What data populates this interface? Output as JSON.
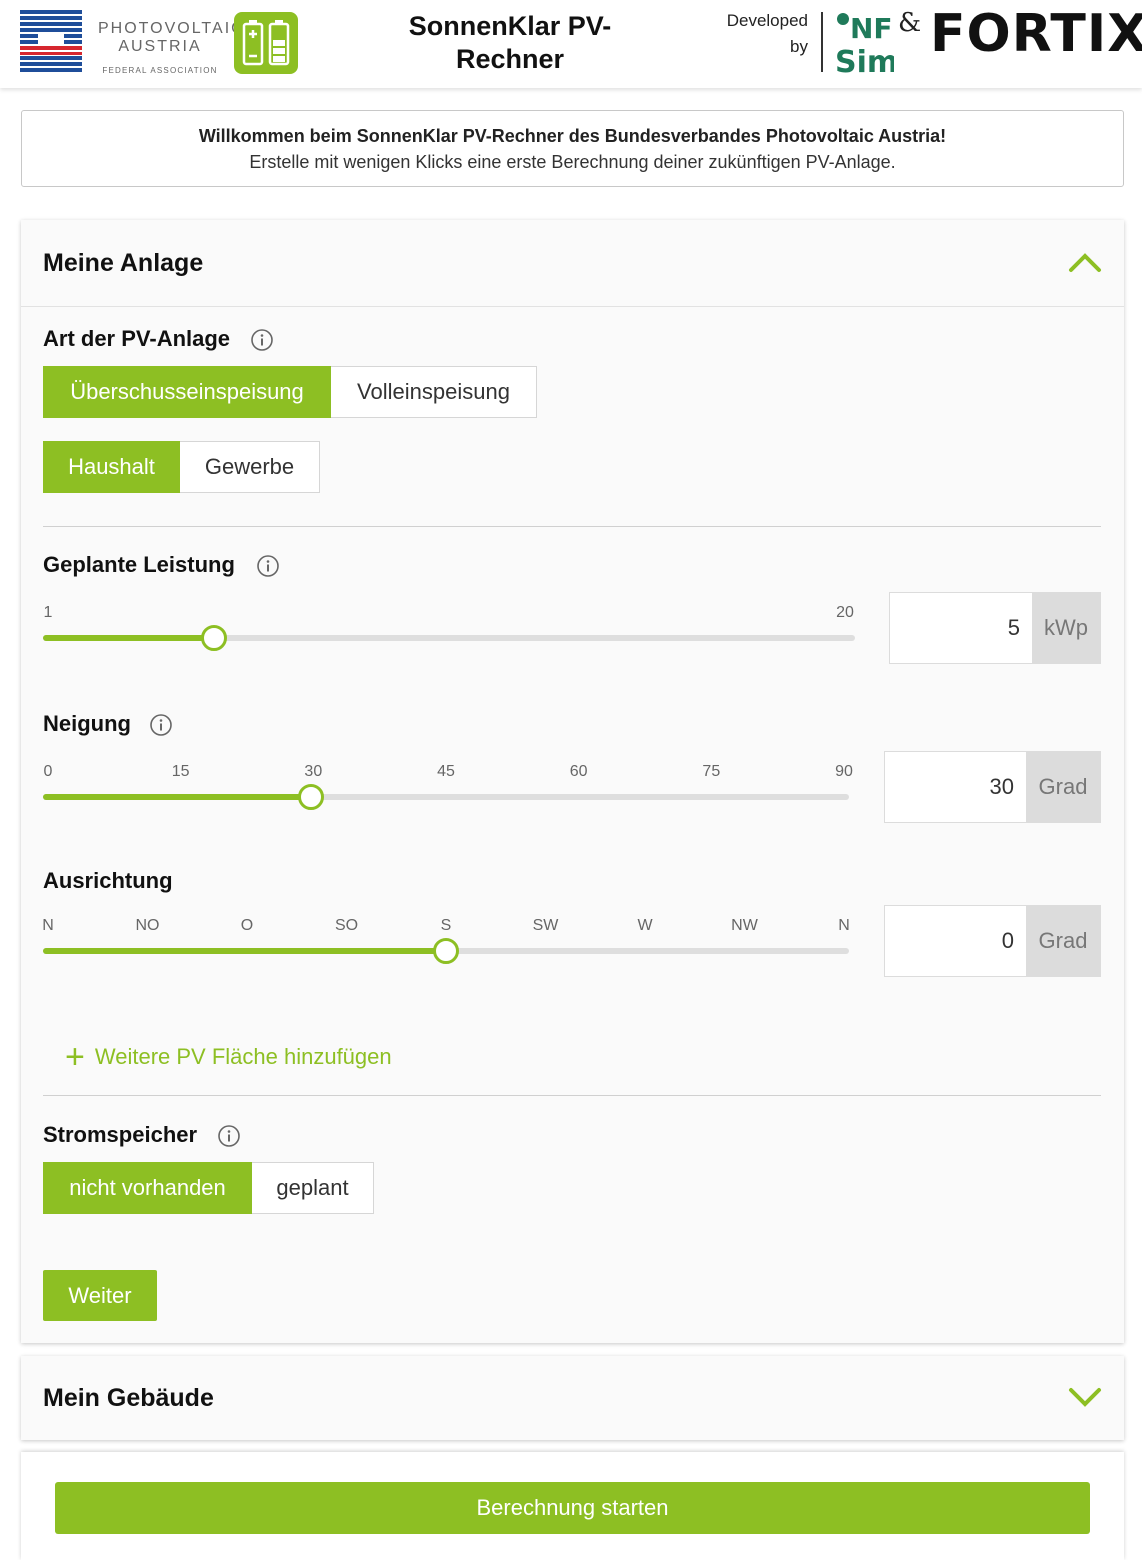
{
  "header": {
    "pva_line1": "PHOTOVOLTAIC",
    "pva_line2": "AUSTRIA",
    "pva_line3": "FEDERAL ASSOCIATION",
    "title": "SonnenKlar PV-Rechner",
    "developed": "Developed",
    "by": "by",
    "onf_top": "NF",
    "onf_bottom": "Sim",
    "amp": "&",
    "fortix": "FORTIX"
  },
  "welcome": {
    "title": "Willkommen beim SonnenKlar PV-Rechner des Bundesverbandes Photovoltaic Austria!",
    "subtitle": "Erstelle mit wenigen Klicks eine erste Berechnung deiner zukünftigen PV-Anlage."
  },
  "colors": {
    "accent": "#8dbf23",
    "unit_bg": "#dcdcdc"
  },
  "anlage": {
    "title": "Meine Anlage",
    "art_label": "Art der PV-Anlage",
    "art_options": [
      "Überschusseinspeisung",
      "Volleinspeisung"
    ],
    "art_selected": "Überschusseinspeisung",
    "typ_options": [
      "Haushalt",
      "Gewerbe"
    ],
    "typ_selected": "Haushalt",
    "leistung": {
      "label": "Geplante Leistung",
      "min_label": "1",
      "max_label": "20",
      "value": "5",
      "unit": "kWp",
      "fraction": 0.21
    },
    "neigung": {
      "label": "Neigung",
      "ticks": [
        "0",
        "15",
        "30",
        "45",
        "60",
        "75",
        "90"
      ],
      "value": "30",
      "unit": "Grad",
      "fraction": 0.333
    },
    "ausrichtung": {
      "label": "Ausrichtung",
      "ticks": [
        "N",
        "NO",
        "O",
        "SO",
        "S",
        "SW",
        "W",
        "NW",
        "N"
      ],
      "value": "0",
      "unit": "Grad",
      "fraction": 0.5
    },
    "add_area": "Weitere PV Fläche hinzufügen",
    "speicher_label": "Stromspeicher",
    "speicher_options": [
      "nicht vorhanden",
      "geplant"
    ],
    "speicher_selected": "nicht vorhanden",
    "next": "Weiter"
  },
  "gebaeude": {
    "title": "Mein Gebäude"
  },
  "calculate": "Berechnung starten"
}
